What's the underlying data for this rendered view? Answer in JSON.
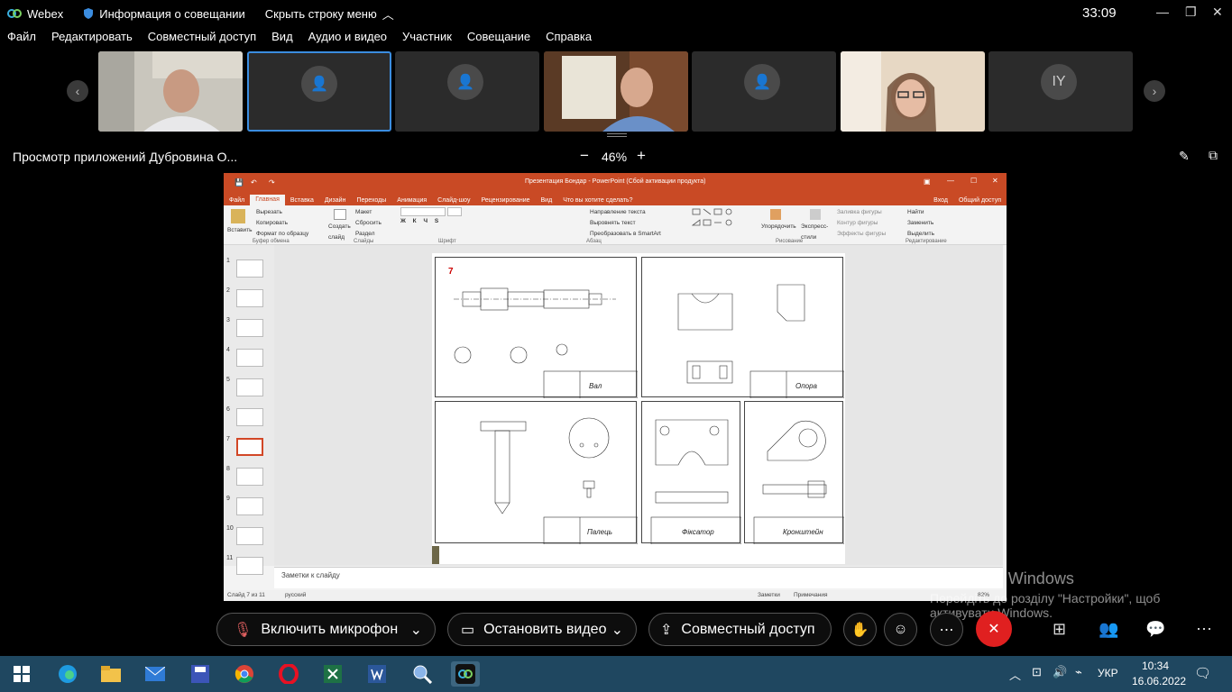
{
  "titlebar": {
    "app": "Webex",
    "meeting_info": "Информация о совещании",
    "hide_menu": "Скрыть строку меню",
    "timer": "33:09"
  },
  "menu": [
    "Файл",
    "Редактировать",
    "Совместный доступ",
    "Вид",
    "Аудио и видео",
    "Участник",
    "Совещание",
    "Справка"
  ],
  "participants": {
    "initials": "IY"
  },
  "share": {
    "title": "Просмотр приложений Дубровина О...",
    "zoom": "46%",
    "minus": "−",
    "plus": "+"
  },
  "ppt": {
    "window_title": "Презентация Бондар - PowerPoint (Сбой активации продукта)",
    "tabs": [
      "Файл",
      "Главная",
      "Вставка",
      "Дизайн",
      "Переходы",
      "Анимация",
      "Слайд-шоу",
      "Рецензирование",
      "Вид",
      "Что вы хотите сделать?"
    ],
    "login": "Вход",
    "share_btn": "Общий доступ",
    "ribbon": {
      "paste": "Вставить",
      "cut": "Вырезать",
      "copy": "Копировать",
      "format_painter": "Формат по образцу",
      "clipboard": "Буфер обмена",
      "new_slide": "Создать слайд",
      "layout": "Макет",
      "reset": "Сбросить",
      "section": "Раздел",
      "slides": "Слайды",
      "font": "Шрифт",
      "text_direction": "Направление текста",
      "align_text": "Выровнять текст",
      "smartart": "Преобразовать в SmartArt",
      "paragraph": "Абзац",
      "arrange": "Упорядочить",
      "quick_styles": "Экспресс-стили",
      "shape_fill": "Заливка фигуры",
      "shape_outline": "Контур фигуры",
      "shape_effects": "Эффекты фигуры",
      "drawing": "Рисование",
      "find": "Найти",
      "replace": "Заменить",
      "select": "Выделить",
      "editing": "Редактирование"
    },
    "slide_numbers": [
      "1",
      "2",
      "3",
      "4",
      "5",
      "6",
      "7",
      "8",
      "9",
      "10",
      "11"
    ],
    "selected_slide": 7,
    "sheets": {
      "s1_number": "7",
      "s1_name": "Вал",
      "s2_name": "Опора",
      "s3_name": "Палець",
      "s4_name": "Фіксатор",
      "s5_name": "Кронштейн"
    },
    "notes": "Заметки к слайду",
    "status": {
      "slide": "Слайд 7 из 11",
      "lang": "русский",
      "notes": "Заметки",
      "comments": "Примечания",
      "zoom": "82%"
    }
  },
  "activation": {
    "line1": "Активація Windows",
    "line2": "Перейдіть до розділу \"Настройки\", щоб",
    "line3": "активувати Windows."
  },
  "controls": {
    "mic": "Включить микрофон",
    "video": "Остановить видео",
    "share": "Совместный доступ"
  },
  "taskbar": {
    "lang": "УКР",
    "time": "10:34",
    "date": "16.06.2022"
  },
  "colors": {
    "ppt_accent": "#c94a25",
    "selection": "#3b8de0",
    "end_call": "#e02020",
    "taskbar": "#1f4760"
  }
}
